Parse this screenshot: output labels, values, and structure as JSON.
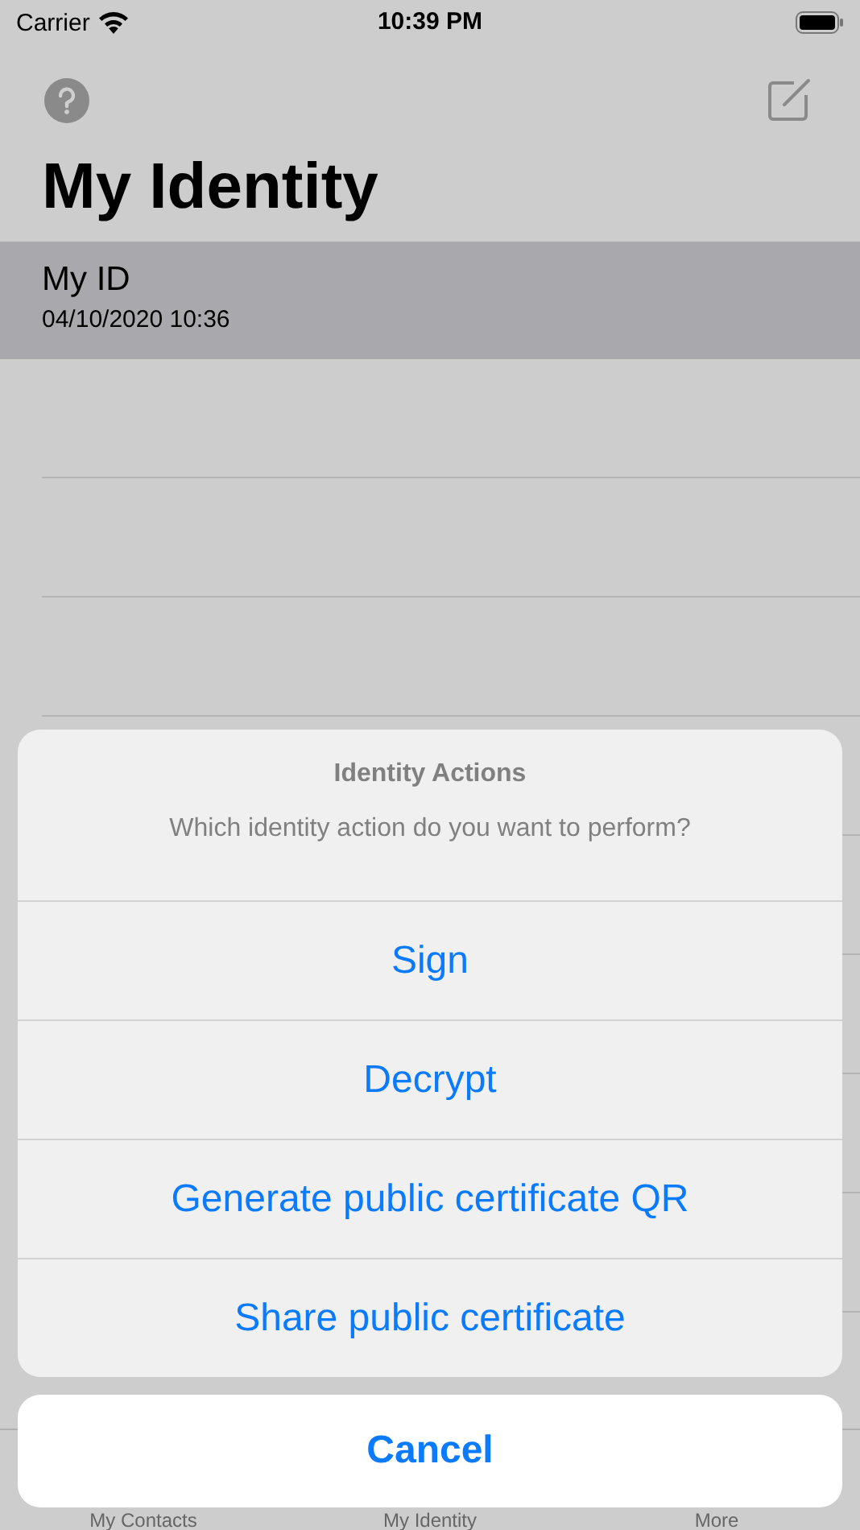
{
  "status_bar": {
    "carrier": "Carrier",
    "time": "10:39 PM"
  },
  "nav": {
    "title": "My Identity"
  },
  "identities": [
    {
      "name": "My ID",
      "date": "04/10/2020 10:36",
      "selected": true
    }
  ],
  "action_sheet": {
    "title": "Identity Actions",
    "message": "Which identity action do you want to perform?",
    "actions": [
      {
        "label": "Sign"
      },
      {
        "label": "Decrypt"
      },
      {
        "label": "Generate public certificate QR"
      },
      {
        "label": "Share public certificate"
      }
    ],
    "cancel": "Cancel"
  },
  "tab_bar": [
    {
      "label": "My Contacts"
    },
    {
      "label": "My Identity"
    },
    {
      "label": "More"
    }
  ]
}
